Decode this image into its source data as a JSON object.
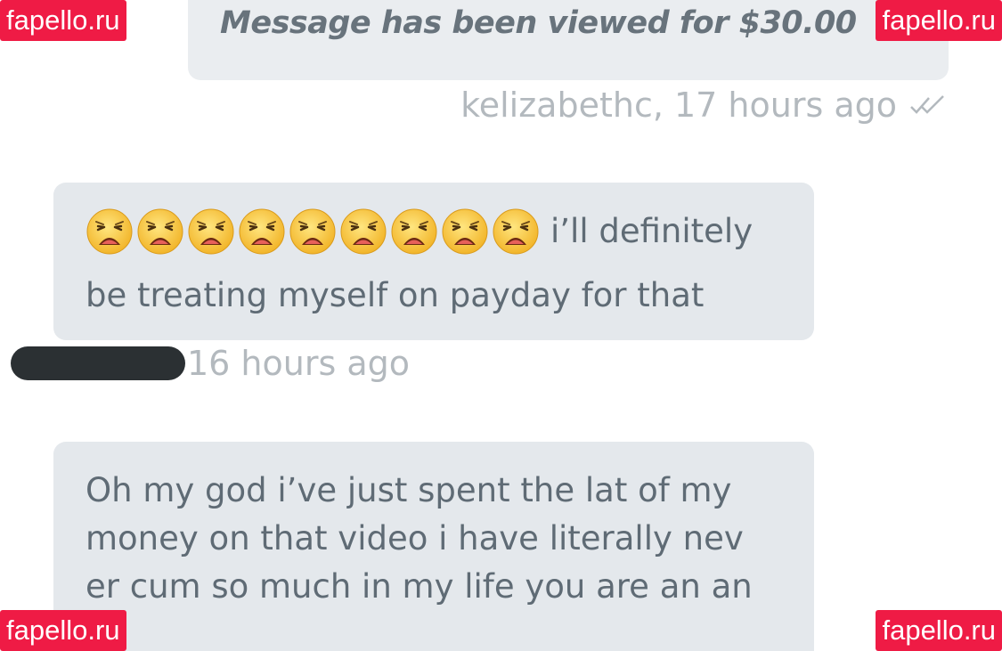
{
  "messages": {
    "sent": {
      "text": "Message has been viewed for $30.00",
      "meta": "kelizabethc, 17 hours ago",
      "status_icon": "double-check-icon"
    },
    "received_1": {
      "emoji": "weary-face-emoji",
      "emoji_count": 9,
      "line1": "i’ll definitely",
      "line2": "be treating myself on payday for that",
      "meta_time": "16 hours ago"
    },
    "received_2": {
      "lines": [
        "Oh my god i’ve just spent the lat of my",
        "money on that video i have literally nev",
        "er cum so much in my life you are an an"
      ]
    }
  },
  "watermarks": {
    "top_left": "fapello.ru",
    "top_right": "fapello.ru",
    "bottom_left": "fapello.ru",
    "bottom_right": "fapello.ru"
  },
  "colors": {
    "bubble": "#e4e8ec",
    "text": "#5f6b75",
    "meta": "#b3b9be",
    "watermark": "#ef1b45"
  }
}
